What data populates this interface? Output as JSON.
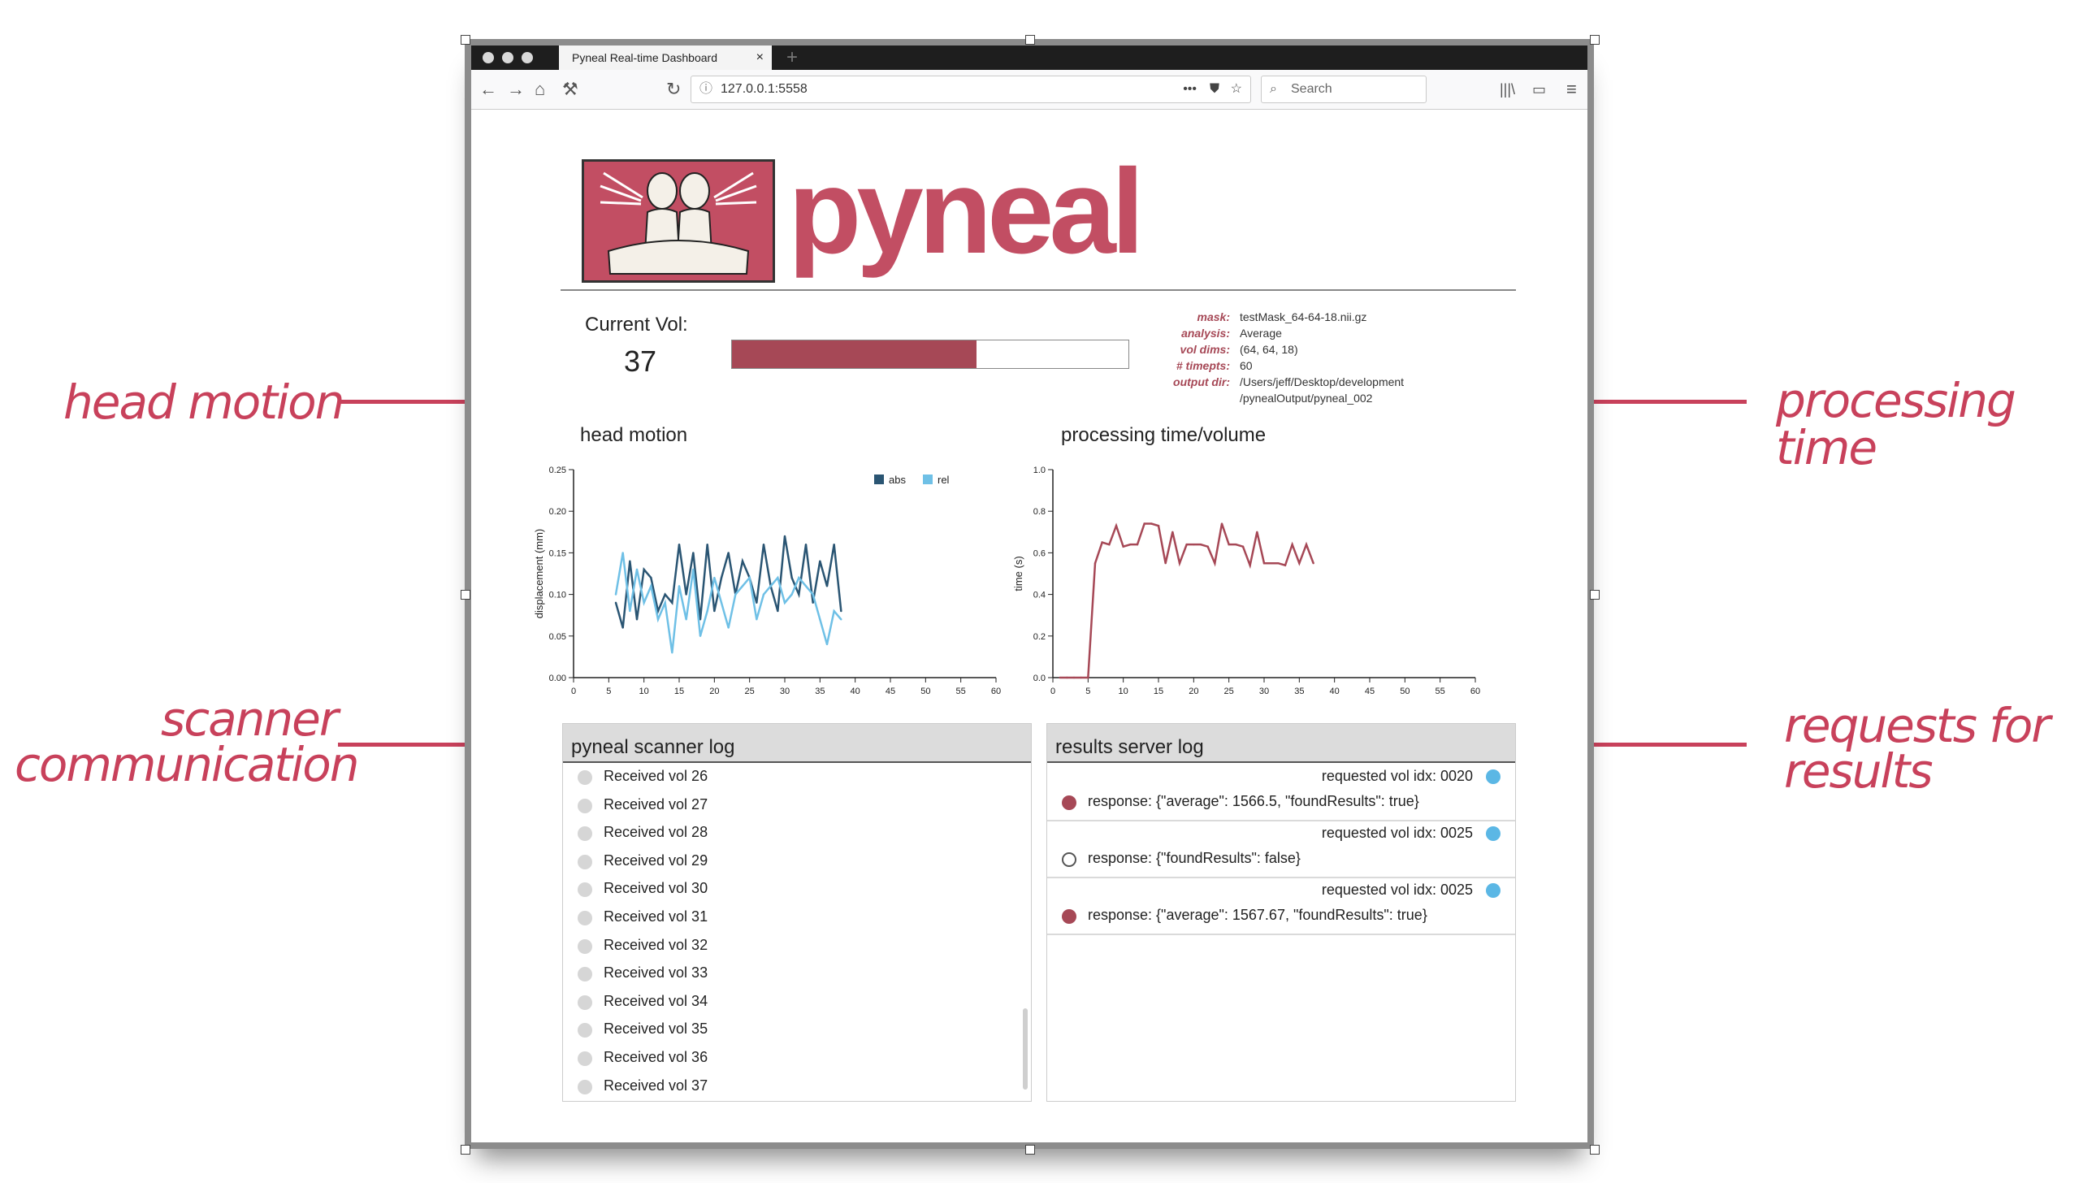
{
  "annotations": {
    "head_motion": "head motion",
    "scanner_line1": "scanner",
    "scanner_line2": "communication",
    "processing_time": "processing time",
    "requests_line1": "requests for",
    "requests_line2": "results"
  },
  "browser": {
    "tab_title": "Pyneal Real-time Dashboard",
    "url": "127.0.0.1:5558",
    "search_placeholder": "Search"
  },
  "page": {
    "logo_text": "pyneal",
    "current_vol_label": "Current Vol:",
    "current_vol": "37",
    "progress_fraction": 0.617,
    "meta": [
      {
        "key": "mask:",
        "value": "testMask_64-64-18.nii.gz"
      },
      {
        "key": "analysis:",
        "value": "Average"
      },
      {
        "key": "vol dims:",
        "value": "(64, 64, 18)"
      },
      {
        "key": "# timepts:",
        "value": "60"
      },
      {
        "key": "output dir:",
        "value": "/Users/jeff/Desktop/development"
      },
      {
        "key": "",
        "value": "/pynealOutput/pyneal_002"
      }
    ]
  },
  "chart_data": [
    {
      "type": "line",
      "title": "head motion",
      "xlabel": "",
      "ylabel": "displacement (mm)",
      "xlim": [
        0,
        60
      ],
      "ylim": [
        0,
        0.25
      ],
      "xticks": [
        "0",
        "5",
        "10",
        "15",
        "20",
        "25",
        "30",
        "35",
        "40",
        "45",
        "50",
        "55",
        "60"
      ],
      "yticks": [
        "0.00",
        "0.05",
        "0.10",
        "0.15",
        "0.20",
        "0.25"
      ],
      "legend_position": "top-right",
      "x": [
        6,
        7,
        8,
        9,
        10,
        11,
        12,
        13,
        14,
        15,
        16,
        17,
        18,
        19,
        20,
        21,
        22,
        23,
        24,
        25,
        26,
        27,
        28,
        29,
        30,
        31,
        32,
        33,
        34,
        35,
        36,
        37,
        38
      ],
      "series": [
        {
          "name": "abs",
          "color": "#2a5573",
          "values": [
            0.09,
            0.06,
            0.14,
            0.07,
            0.13,
            0.12,
            0.08,
            0.1,
            0.09,
            0.16,
            0.1,
            0.15,
            0.07,
            0.16,
            0.08,
            0.12,
            0.15,
            0.1,
            0.14,
            0.12,
            0.09,
            0.16,
            0.11,
            0.08,
            0.17,
            0.12,
            0.1,
            0.16,
            0.09,
            0.14,
            0.11,
            0.16,
            0.08
          ]
        },
        {
          "name": "rel",
          "color": "#6fc0e6",
          "values": [
            0.1,
            0.15,
            0.08,
            0.13,
            0.09,
            0.11,
            0.07,
            0.09,
            0.03,
            0.11,
            0.07,
            0.13,
            0.05,
            0.08,
            0.12,
            0.09,
            0.06,
            0.1,
            0.11,
            0.12,
            0.07,
            0.1,
            0.11,
            0.12,
            0.09,
            0.1,
            0.12,
            0.11,
            0.1,
            0.07,
            0.04,
            0.08,
            0.07
          ]
        }
      ]
    },
    {
      "type": "line",
      "title": "processing time/volume",
      "xlabel": "",
      "ylabel": "time (s)",
      "xlim": [
        0,
        60
      ],
      "ylim": [
        0,
        1.0
      ],
      "xticks": [
        "0",
        "5",
        "10",
        "15",
        "20",
        "25",
        "30",
        "35",
        "40",
        "45",
        "50",
        "55",
        "60"
      ],
      "yticks": [
        "0.0",
        "0.2",
        "0.4",
        "0.6",
        "0.8",
        "1.0"
      ],
      "x": [
        1,
        2,
        3,
        4,
        5,
        6,
        7,
        8,
        9,
        10,
        11,
        12,
        13,
        14,
        15,
        16,
        17,
        18,
        19,
        20,
        21,
        22,
        23,
        24,
        25,
        26,
        27,
        28,
        29,
        30,
        31,
        32,
        33,
        34,
        35,
        36,
        37
      ],
      "series": [
        {
          "name": "",
          "color": "#a64856",
          "values": [
            0.0,
            0.0,
            0.0,
            0.0,
            0.0,
            0.55,
            0.65,
            0.64,
            0.73,
            0.63,
            0.64,
            0.64,
            0.74,
            0.74,
            0.73,
            0.55,
            0.7,
            0.55,
            0.64,
            0.64,
            0.64,
            0.63,
            0.55,
            0.74,
            0.64,
            0.64,
            0.63,
            0.54,
            0.7,
            0.55,
            0.55,
            0.55,
            0.54,
            0.64,
            0.55,
            0.64,
            0.55
          ]
        }
      ]
    }
  ],
  "scanner_log": {
    "title": "pyneal scanner log",
    "items": [
      "Received vol 26",
      "Received vol 27",
      "Received vol 28",
      "Received vol 29",
      "Received vol 30",
      "Received vol 31",
      "Received vol 32",
      "Received vol 33",
      "Received vol 34",
      "Received vol 35",
      "Received vol 36",
      "Received vol 37"
    ]
  },
  "results_log": {
    "title": "results server log",
    "entries": [
      {
        "request": "requested vol idx: 0020",
        "response": "response: {\"average\": 1566.5, \"foundResults\": true}",
        "found": true
      },
      {
        "request": "requested vol idx: 0025",
        "response": "response: {\"foundResults\": false}",
        "found": false
      },
      {
        "request": "requested vol idx: 0025",
        "response": "response: {\"average\": 1567.67, \"foundResults\": true}",
        "found": true
      }
    ]
  },
  "colors": {
    "accent": "#c8415b",
    "brand": "#c24e63",
    "progress": "#a64856",
    "request_dot": "#5bb7e5"
  }
}
